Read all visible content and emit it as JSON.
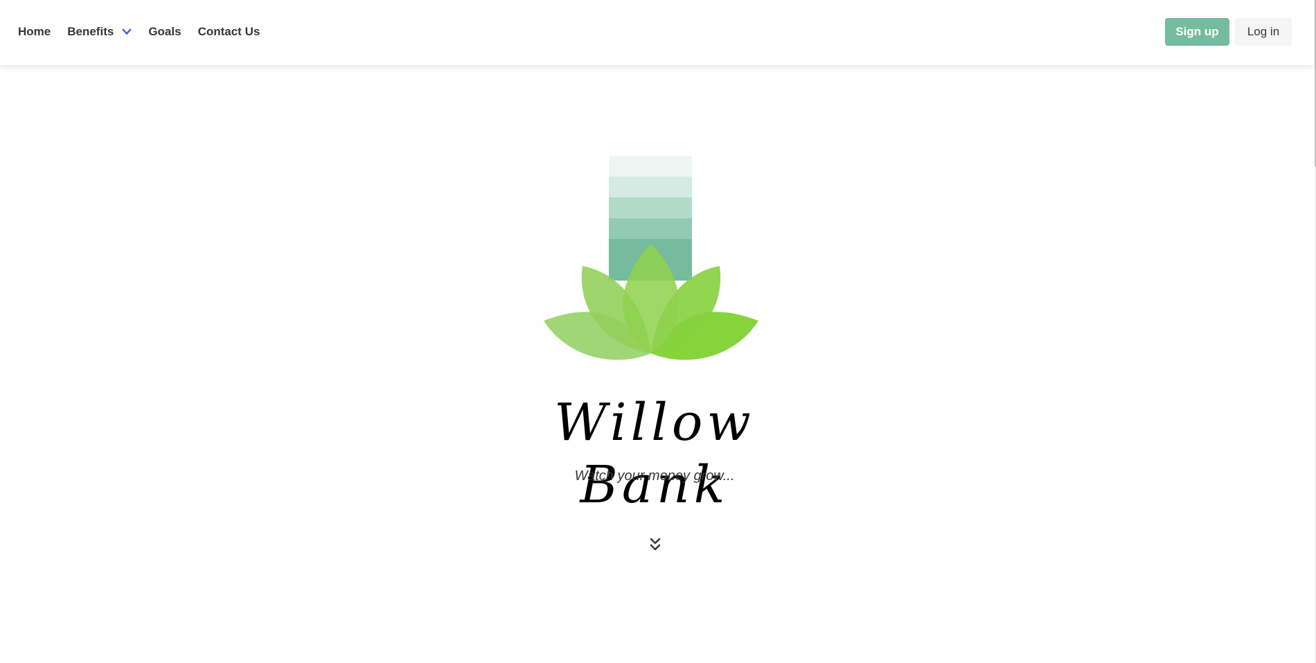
{
  "nav": {
    "items": [
      {
        "label": "Home"
      },
      {
        "label": "Benefits"
      },
      {
        "label": "Goals"
      },
      {
        "label": "Contact Us"
      }
    ],
    "signup_label": "Sign up",
    "login_label": "Log in"
  },
  "hero": {
    "brand_name": "Willow Bank",
    "tagline": "Watch your money grow...",
    "logo_icon": "lotus-logo-icon",
    "scroll_icon": "double-chevron-down-icon"
  },
  "colors": {
    "accent": "#75bb9d",
    "caret": "#3b5bdb",
    "leaf_light": "#a6d98a",
    "leaf_dark": "#7fd132"
  }
}
